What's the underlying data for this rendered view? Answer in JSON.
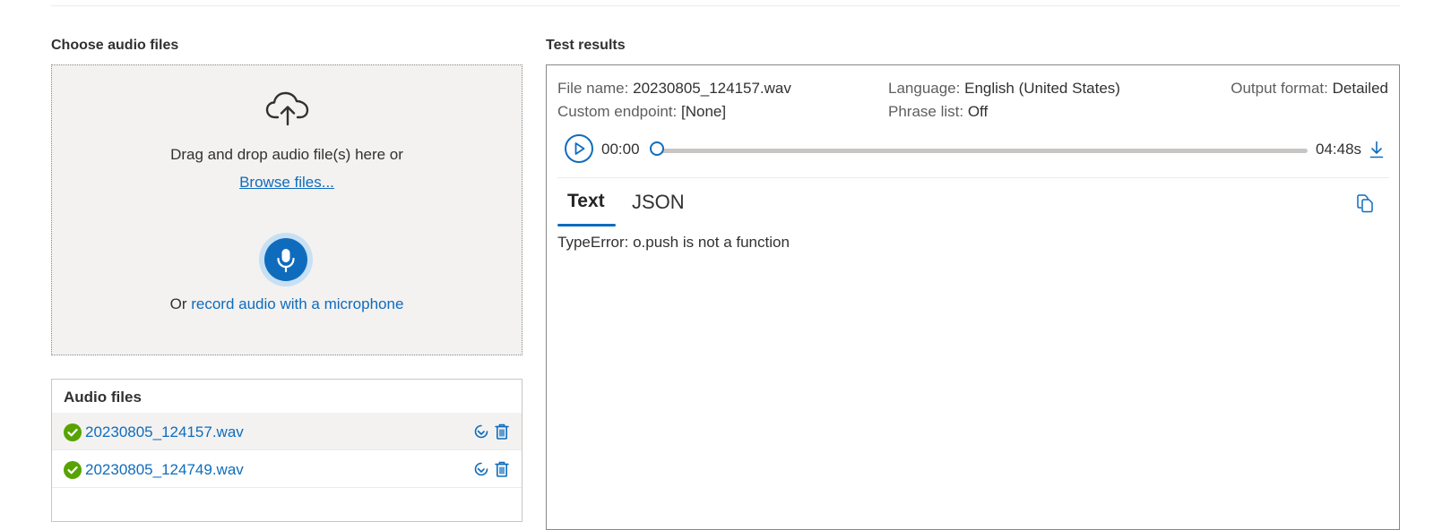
{
  "left": {
    "title": "Choose audio files",
    "dropzone": {
      "icon": "cloud-upload-icon",
      "drag_text": "Drag and drop audio file(s) here or",
      "browse_label": "Browse files...",
      "mic_icon": "microphone-icon",
      "record_prefix": "Or",
      "record_link": "record audio with a microphone"
    },
    "audio_files": {
      "title": "Audio files",
      "items": [
        {
          "name": "20230805_124157.wav",
          "status": "success",
          "selected": true
        },
        {
          "name": "20230805_124749.wav",
          "status": "success",
          "selected": false
        }
      ]
    }
  },
  "right": {
    "title": "Test results",
    "meta": {
      "file_name_label": "File name:",
      "file_name_value": "20230805_124157.wav",
      "language_label": "Language:",
      "language_value": "English (United States)",
      "output_format_label": "Output format:",
      "output_format_value": "Detailed",
      "endpoint_label": "Custom endpoint:",
      "endpoint_value": "[None]",
      "phrase_list_label": "Phrase list:",
      "phrase_list_value": "Off"
    },
    "player": {
      "current_time": "00:00",
      "duration": "04:48s",
      "progress": 0
    },
    "tabs": [
      {
        "label": "Text",
        "active": true
      },
      {
        "label": "JSON",
        "active": false
      }
    ],
    "result_text": "TypeError: o.push is not a function"
  },
  "colors": {
    "accent": "#0f6cbd",
    "success": "#57a300",
    "dropzone_bg": "#f3f2f1",
    "text": "#323130"
  }
}
